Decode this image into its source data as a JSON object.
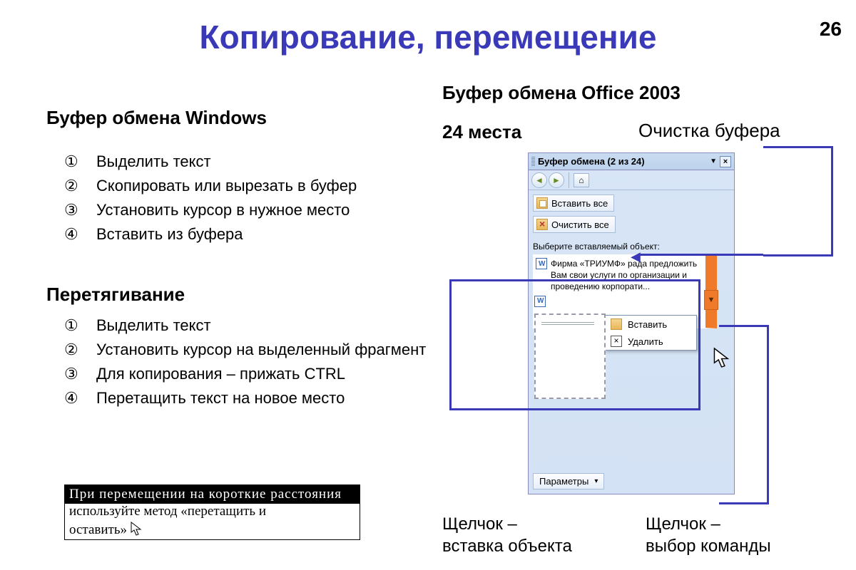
{
  "page_number": "26",
  "title": "Копирование, перемещение",
  "left": {
    "windows_heading": "Буфер обмена Windows",
    "windows_steps": [
      "Выделить текст",
      "Скопировать или вырезать в буфер",
      "Установить курсор в нужное место",
      "Вставить из буфера"
    ],
    "drag_heading": "Перетягивание",
    "drag_steps": [
      "Выделить текст",
      "Установить курсор на выделенный фрагмент",
      "Для копирования – прижать CTRL",
      "Перетащить текст на новое место"
    ],
    "drag_box_line1": "При перемещении на короткие расстояния",
    "drag_box_line2": "используйте метод «перетащить и",
    "drag_box_line3": "оставить»"
  },
  "right": {
    "office_heading": "Буфер обмена Office 2003",
    "capacity": "24 места",
    "label_clear": "Очистка буфера",
    "annot_insert": "Щелчок – вставка объекта",
    "annot_command": "Щелчок – выбор команды"
  },
  "pane": {
    "title": "Буфер обмена (2 из 24)",
    "paste_all": "Вставить все",
    "clear_all": "Очистить все",
    "hint": "Выберите вставляемый объект:",
    "item_text": "Фирма «ТРИУМФ» рада предложить Вам свои услуги по организации и проведению корпорати...",
    "ctx_paste": "Вставить",
    "ctx_delete": "Удалить",
    "params": "Параметры"
  }
}
